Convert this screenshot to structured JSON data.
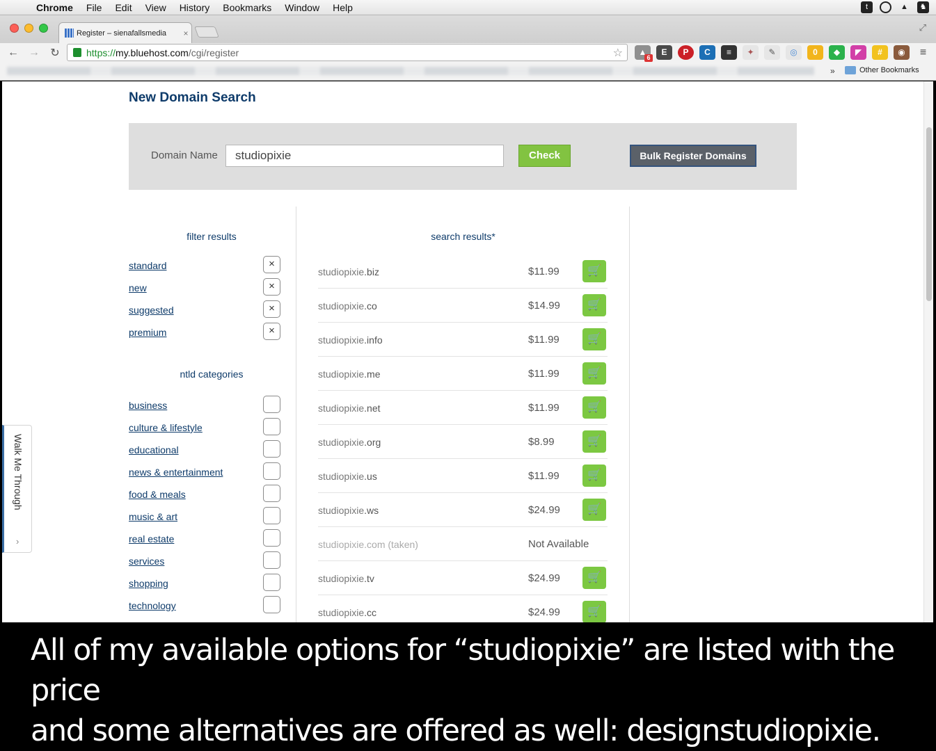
{
  "menubar": {
    "items": [
      "Chrome",
      "File",
      "Edit",
      "View",
      "History",
      "Bookmarks",
      "Window",
      "Help"
    ]
  },
  "tab": {
    "title": "Register – sienafallsmedia",
    "close": "×"
  },
  "address": {
    "scheme": "https://",
    "host": "my.bluehost.com",
    "path": "/cgi/register"
  },
  "extensions": {
    "badge_count": "6"
  },
  "bookmarks": {
    "more": "»",
    "other": "Other Bookmarks"
  },
  "page": {
    "title": "New Domain Search",
    "search": {
      "label": "Domain Name",
      "value": "studiopixie",
      "check_label": "Check",
      "bulk_label": "Bulk Register Domains"
    },
    "filter": {
      "title": "filter results",
      "items": [
        "standard",
        "new",
        "suggested",
        "premium"
      ]
    },
    "categories": {
      "title": "ntld categories",
      "items": [
        "business",
        "culture & lifestyle",
        "educational",
        "news & entertainment",
        "food & meals",
        "music & art",
        "real estate",
        "services",
        "shopping",
        "technology"
      ]
    },
    "results": {
      "title": "search results*",
      "rows": [
        {
          "name": "studiopixie",
          "tld": ".biz",
          "price": "$11.99",
          "available": true
        },
        {
          "name": "studiopixie",
          "tld": ".co",
          "price": "$14.99",
          "available": true
        },
        {
          "name": "studiopixie",
          "tld": ".info",
          "price": "$11.99",
          "available": true
        },
        {
          "name": "studiopixie",
          "tld": ".me",
          "price": "$11.99",
          "available": true
        },
        {
          "name": "studiopixie",
          "tld": ".net",
          "price": "$11.99",
          "available": true
        },
        {
          "name": "studiopixie",
          "tld": ".org",
          "price": "$8.99",
          "available": true
        },
        {
          "name": "studiopixie",
          "tld": ".us",
          "price": "$11.99",
          "available": true
        },
        {
          "name": "studiopixie",
          "tld": ".ws",
          "price": "$24.99",
          "available": true
        },
        {
          "name": "studiopixie.com (taken)",
          "tld": "",
          "price": "Not Available",
          "available": false
        },
        {
          "name": "studiopixie",
          "tld": ".tv",
          "price": "$24.99",
          "available": true
        },
        {
          "name": "studiopixie",
          "tld": ".cc",
          "price": "$24.99",
          "available": true
        }
      ]
    },
    "walk_me_through": "Walk Me Through"
  },
  "caption": {
    "line1": "All of my available options for “studiopixie” are listed with the price",
    "line2": "and some alternatives are offered as well: designstudiopixie."
  },
  "colors": {
    "brand_navy": "#0e3b6a",
    "check_green": "#82c341",
    "cart_green": "#7cc842",
    "bulk_gray": "#5b6169"
  }
}
